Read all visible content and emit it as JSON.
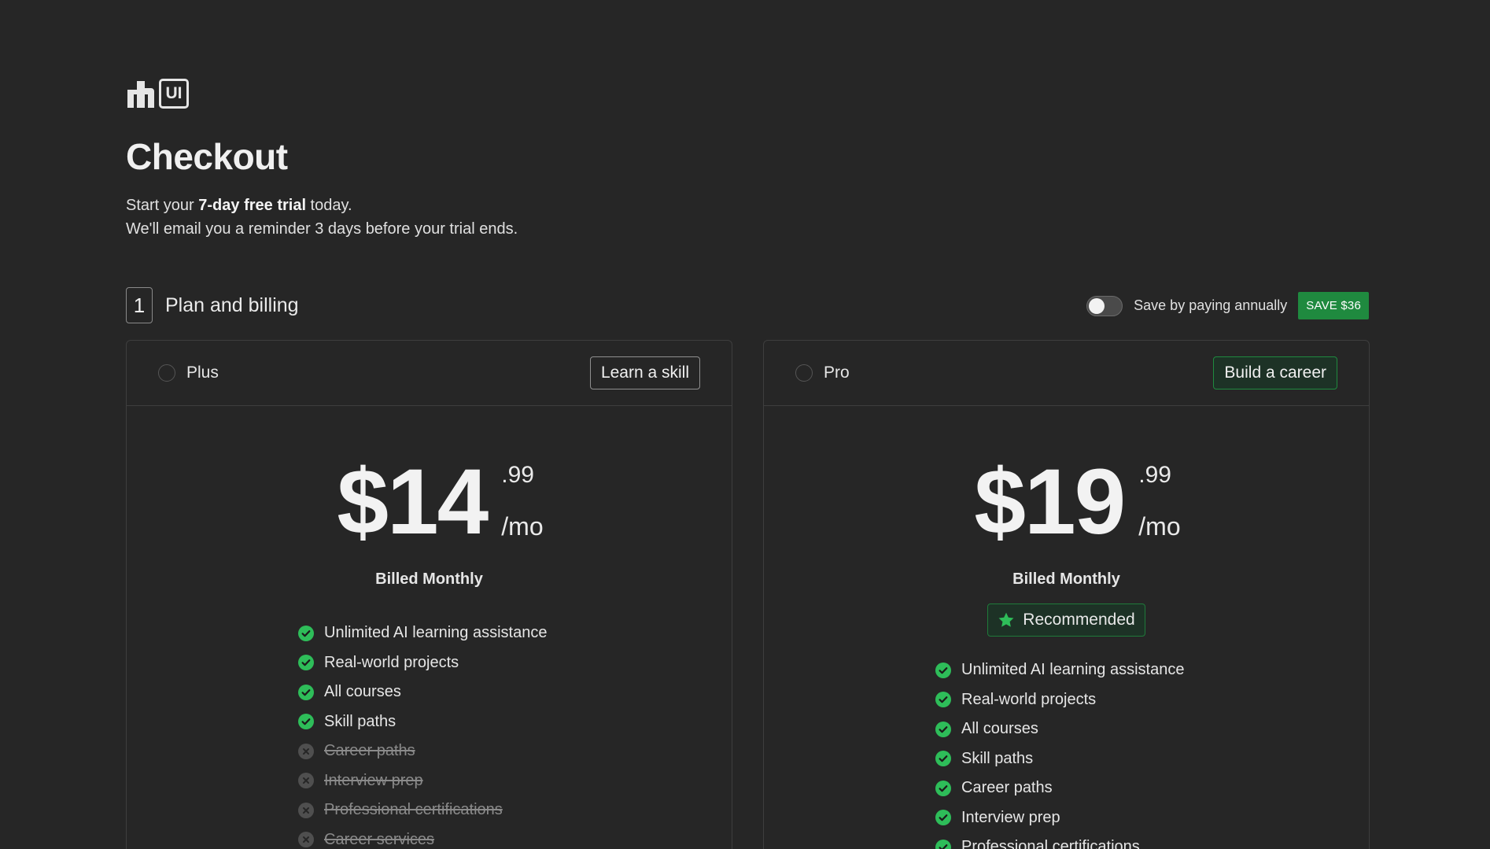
{
  "brand": {
    "logo_text": "UI"
  },
  "page": {
    "title": "Checkout",
    "intro_prefix": "Start your ",
    "intro_bold": "7-day free trial",
    "intro_suffix": " today.",
    "intro_line2": "We'll email you a reminder 3 days before your trial ends."
  },
  "section": {
    "number": "1",
    "title": "Plan and billing"
  },
  "annual": {
    "label": "Save by paying annually",
    "badge": "SAVE $36",
    "enabled": false
  },
  "plans": [
    {
      "name": "Plus",
      "tag": "Learn a skill",
      "price_whole": "$14",
      "price_cents": ".99",
      "period": "/mo",
      "billing": "Billed Monthly",
      "features": [
        {
          "label": "Unlimited AI learning assistance",
          "included": true
        },
        {
          "label": "Real-world projects",
          "included": true
        },
        {
          "label": "All courses",
          "included": true
        },
        {
          "label": "Skill paths",
          "included": true
        },
        {
          "label": "Career paths",
          "included": false
        },
        {
          "label": "Interview prep",
          "included": false
        },
        {
          "label": "Professional certifications",
          "included": false
        },
        {
          "label": "Career services",
          "included": false
        }
      ]
    },
    {
      "name": "Pro",
      "tag": "Build a career",
      "price_whole": "$19",
      "price_cents": ".99",
      "period": "/mo",
      "billing": "Billed Monthly",
      "recommended": "Recommended",
      "features": [
        {
          "label": "Unlimited AI learning assistance",
          "included": true
        },
        {
          "label": "Real-world projects",
          "included": true
        },
        {
          "label": "All courses",
          "included": true
        },
        {
          "label": "Skill paths",
          "included": true
        },
        {
          "label": "Career paths",
          "included": true
        },
        {
          "label": "Interview prep",
          "included": true
        },
        {
          "label": "Professional certifications",
          "included": true
        }
      ]
    }
  ],
  "colors": {
    "background": "#262626",
    "accent_green": "#1f8a3f",
    "check_green": "#2ebd59",
    "muted": "#5a5a5a"
  },
  "icons": {
    "included": "check-circle-icon",
    "excluded": "x-circle-icon",
    "recommended": "star-icon"
  }
}
